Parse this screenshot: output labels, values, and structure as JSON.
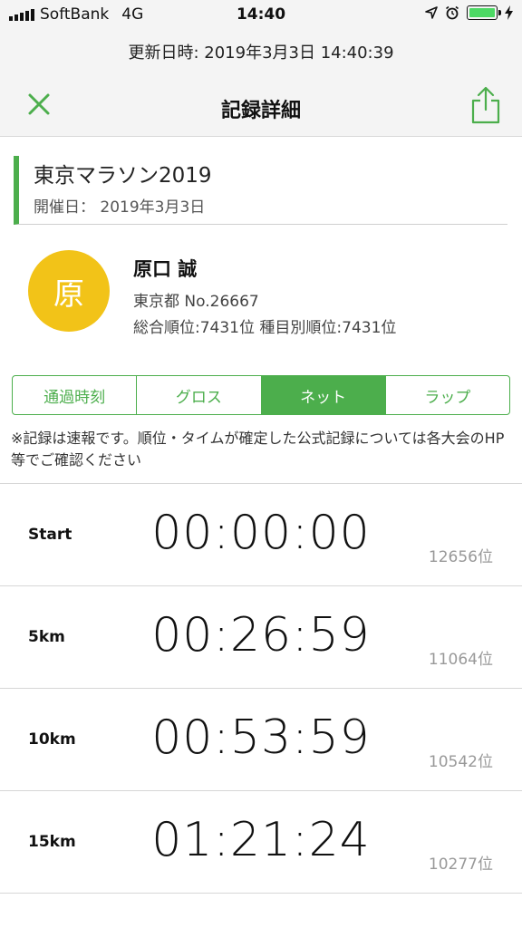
{
  "status_bar": {
    "carrier": "SoftBank",
    "network": "4G",
    "time": "14:40",
    "battery_color": "#4cd964"
  },
  "header": {
    "updated": "更新日時: 2019年3月3日 14:40:39",
    "title": "記録詳細",
    "close_icon": "close-icon",
    "share_icon": "share-icon"
  },
  "race": {
    "name": "東京マラソン2019",
    "date": "開催日： 2019年3月3日"
  },
  "runner": {
    "avatar_char": "原",
    "name": "原口 誠",
    "meta": "東京都  No.26667",
    "rank": "総合順位:7431位 種目別順位:7431位"
  },
  "tabs": [
    {
      "label": "通過時刻",
      "active": false
    },
    {
      "label": "グロス",
      "active": false
    },
    {
      "label": "ネット",
      "active": true
    },
    {
      "label": "ラップ",
      "active": false
    }
  ],
  "notice": "※記録は速報です。順位・タイムが確定した公式記録については各大会のHP等でご確認ください",
  "splits": [
    {
      "label": "Start",
      "time": "00:00:00",
      "rank": "12656位"
    },
    {
      "label": "5km",
      "time": "00:26:59",
      "rank": "11064位"
    },
    {
      "label": "10km",
      "time": "00:53:59",
      "rank": "10542位"
    },
    {
      "label": "15km",
      "time": "01:21:24",
      "rank": "10277位"
    }
  ],
  "colors": {
    "accent": "#4cae4c",
    "avatar": "#f2c318"
  }
}
